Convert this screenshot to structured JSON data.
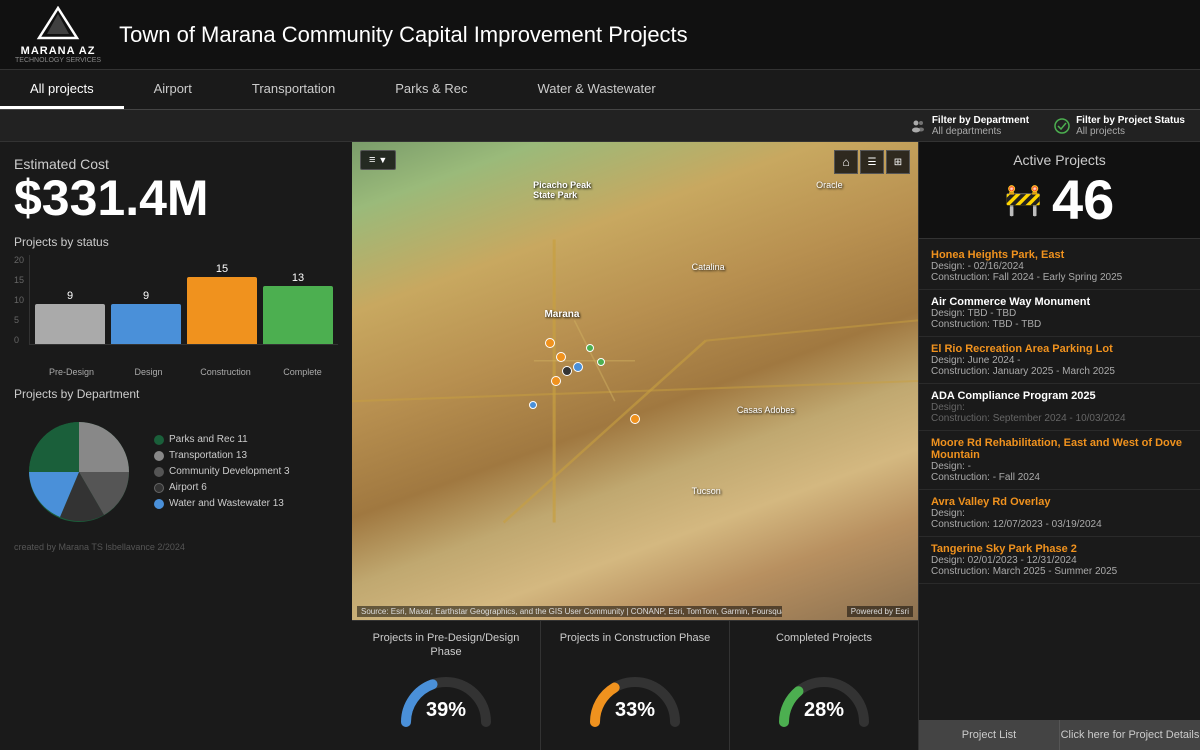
{
  "header": {
    "logo_text": "MARANA AZ",
    "logo_sub": "TECHNOLOGY SERVICES",
    "title": "Town of Marana Community Capital Improvement Projects"
  },
  "nav": {
    "items": [
      {
        "label": "All projects",
        "active": true
      },
      {
        "label": "Airport",
        "active": false
      },
      {
        "label": "Transportation",
        "active": false
      },
      {
        "label": "Parks & Rec",
        "active": false
      },
      {
        "label": "Water & Wastewater",
        "active": false
      }
    ]
  },
  "filters": {
    "department_label": "Filter by Department",
    "department_value": "All departments",
    "status_label": "Filter by Project Status",
    "status_value": "All projects"
  },
  "estimated_cost": {
    "label": "Estimated Cost",
    "value": "$331.4M"
  },
  "projects_by_status": {
    "title": "Projects by status",
    "bars": [
      {
        "label": "Pre-Design",
        "value": 9,
        "color": "#aaa"
      },
      {
        "label": "Design",
        "value": 9,
        "color": "#4a90d9"
      },
      {
        "label": "Construction",
        "value": 15,
        "color": "#f0921e"
      },
      {
        "label": "Complete",
        "value": 13,
        "color": "#4caf50"
      }
    ],
    "max": 20
  },
  "projects_by_dept": {
    "title": "Projects by Department",
    "segments": [
      {
        "label": "Parks and Rec 11",
        "value": 11,
        "color": "#1a5f3a"
      },
      {
        "label": "Transportation 13",
        "value": 13,
        "color": "#888"
      },
      {
        "label": "Community Development 3",
        "value": 3,
        "color": "#555"
      },
      {
        "label": "Airport 6",
        "value": 6,
        "color": "#333"
      },
      {
        "label": "Water and Wastewater 13",
        "value": 13,
        "color": "#4a90d9"
      }
    ]
  },
  "map": {
    "source_text": "Source: Esri, Maxar, Earthstar Geographics, and the GIS User Community | CONANP, Esri, TomTom, Garmin, Foursquare, Saf...",
    "powered_text": "Powered by Esri"
  },
  "stats": [
    {
      "title": "Projects in Pre-Design/Design Phase",
      "percent": 39,
      "color": "#4a90d9"
    },
    {
      "title": "Projects in Construction Phase",
      "percent": 33,
      "color": "#f0921e"
    },
    {
      "title": "Completed Projects",
      "percent": 28,
      "color": "#4caf50"
    }
  ],
  "active_projects": {
    "title": "Active Projects",
    "count": "46"
  },
  "project_list": [
    {
      "name": "Honea Heights Park, East",
      "highlight": true,
      "design": "Design: - 02/16/2024",
      "construction": "Construction: Fall 2024 - Early Spring 2025"
    },
    {
      "name": "Air Commerce Way Monument",
      "highlight": false,
      "design": "Design: TBD - TBD",
      "construction": "Construction: TBD - TBD"
    },
    {
      "name": "El Rio Recreation Area Parking Lot",
      "highlight": true,
      "design": "Design: June 2024 -",
      "construction": "Construction: January 2025 - March 2025"
    },
    {
      "name": "ADA Compliance Program 2025",
      "highlight": false,
      "design": "Design:",
      "construction": "Construction: September 2024 - 10/03/2024",
      "muted": true
    },
    {
      "name": "Moore Rd Rehabilitation, East and West of Dove Mountain",
      "highlight": true,
      "design": "Design: -",
      "construction": "Construction: - Fall 2024"
    },
    {
      "name": "Avra Valley Rd Overlay",
      "highlight": true,
      "design": "Design:",
      "construction": "Construction: 12/07/2023 - 03/19/2024"
    },
    {
      "name": "Tangerine Sky Park Phase 2",
      "highlight": true,
      "design": "Design: 02/01/2023 - 12/31/2024",
      "construction": "Construction: March 2025 - Summer 2025"
    }
  ],
  "bottom_bar": {
    "btn1": "Project List",
    "btn2": "Click here for Project Details"
  },
  "watermark": "created by Marana TS lsbellavance 2/2024"
}
